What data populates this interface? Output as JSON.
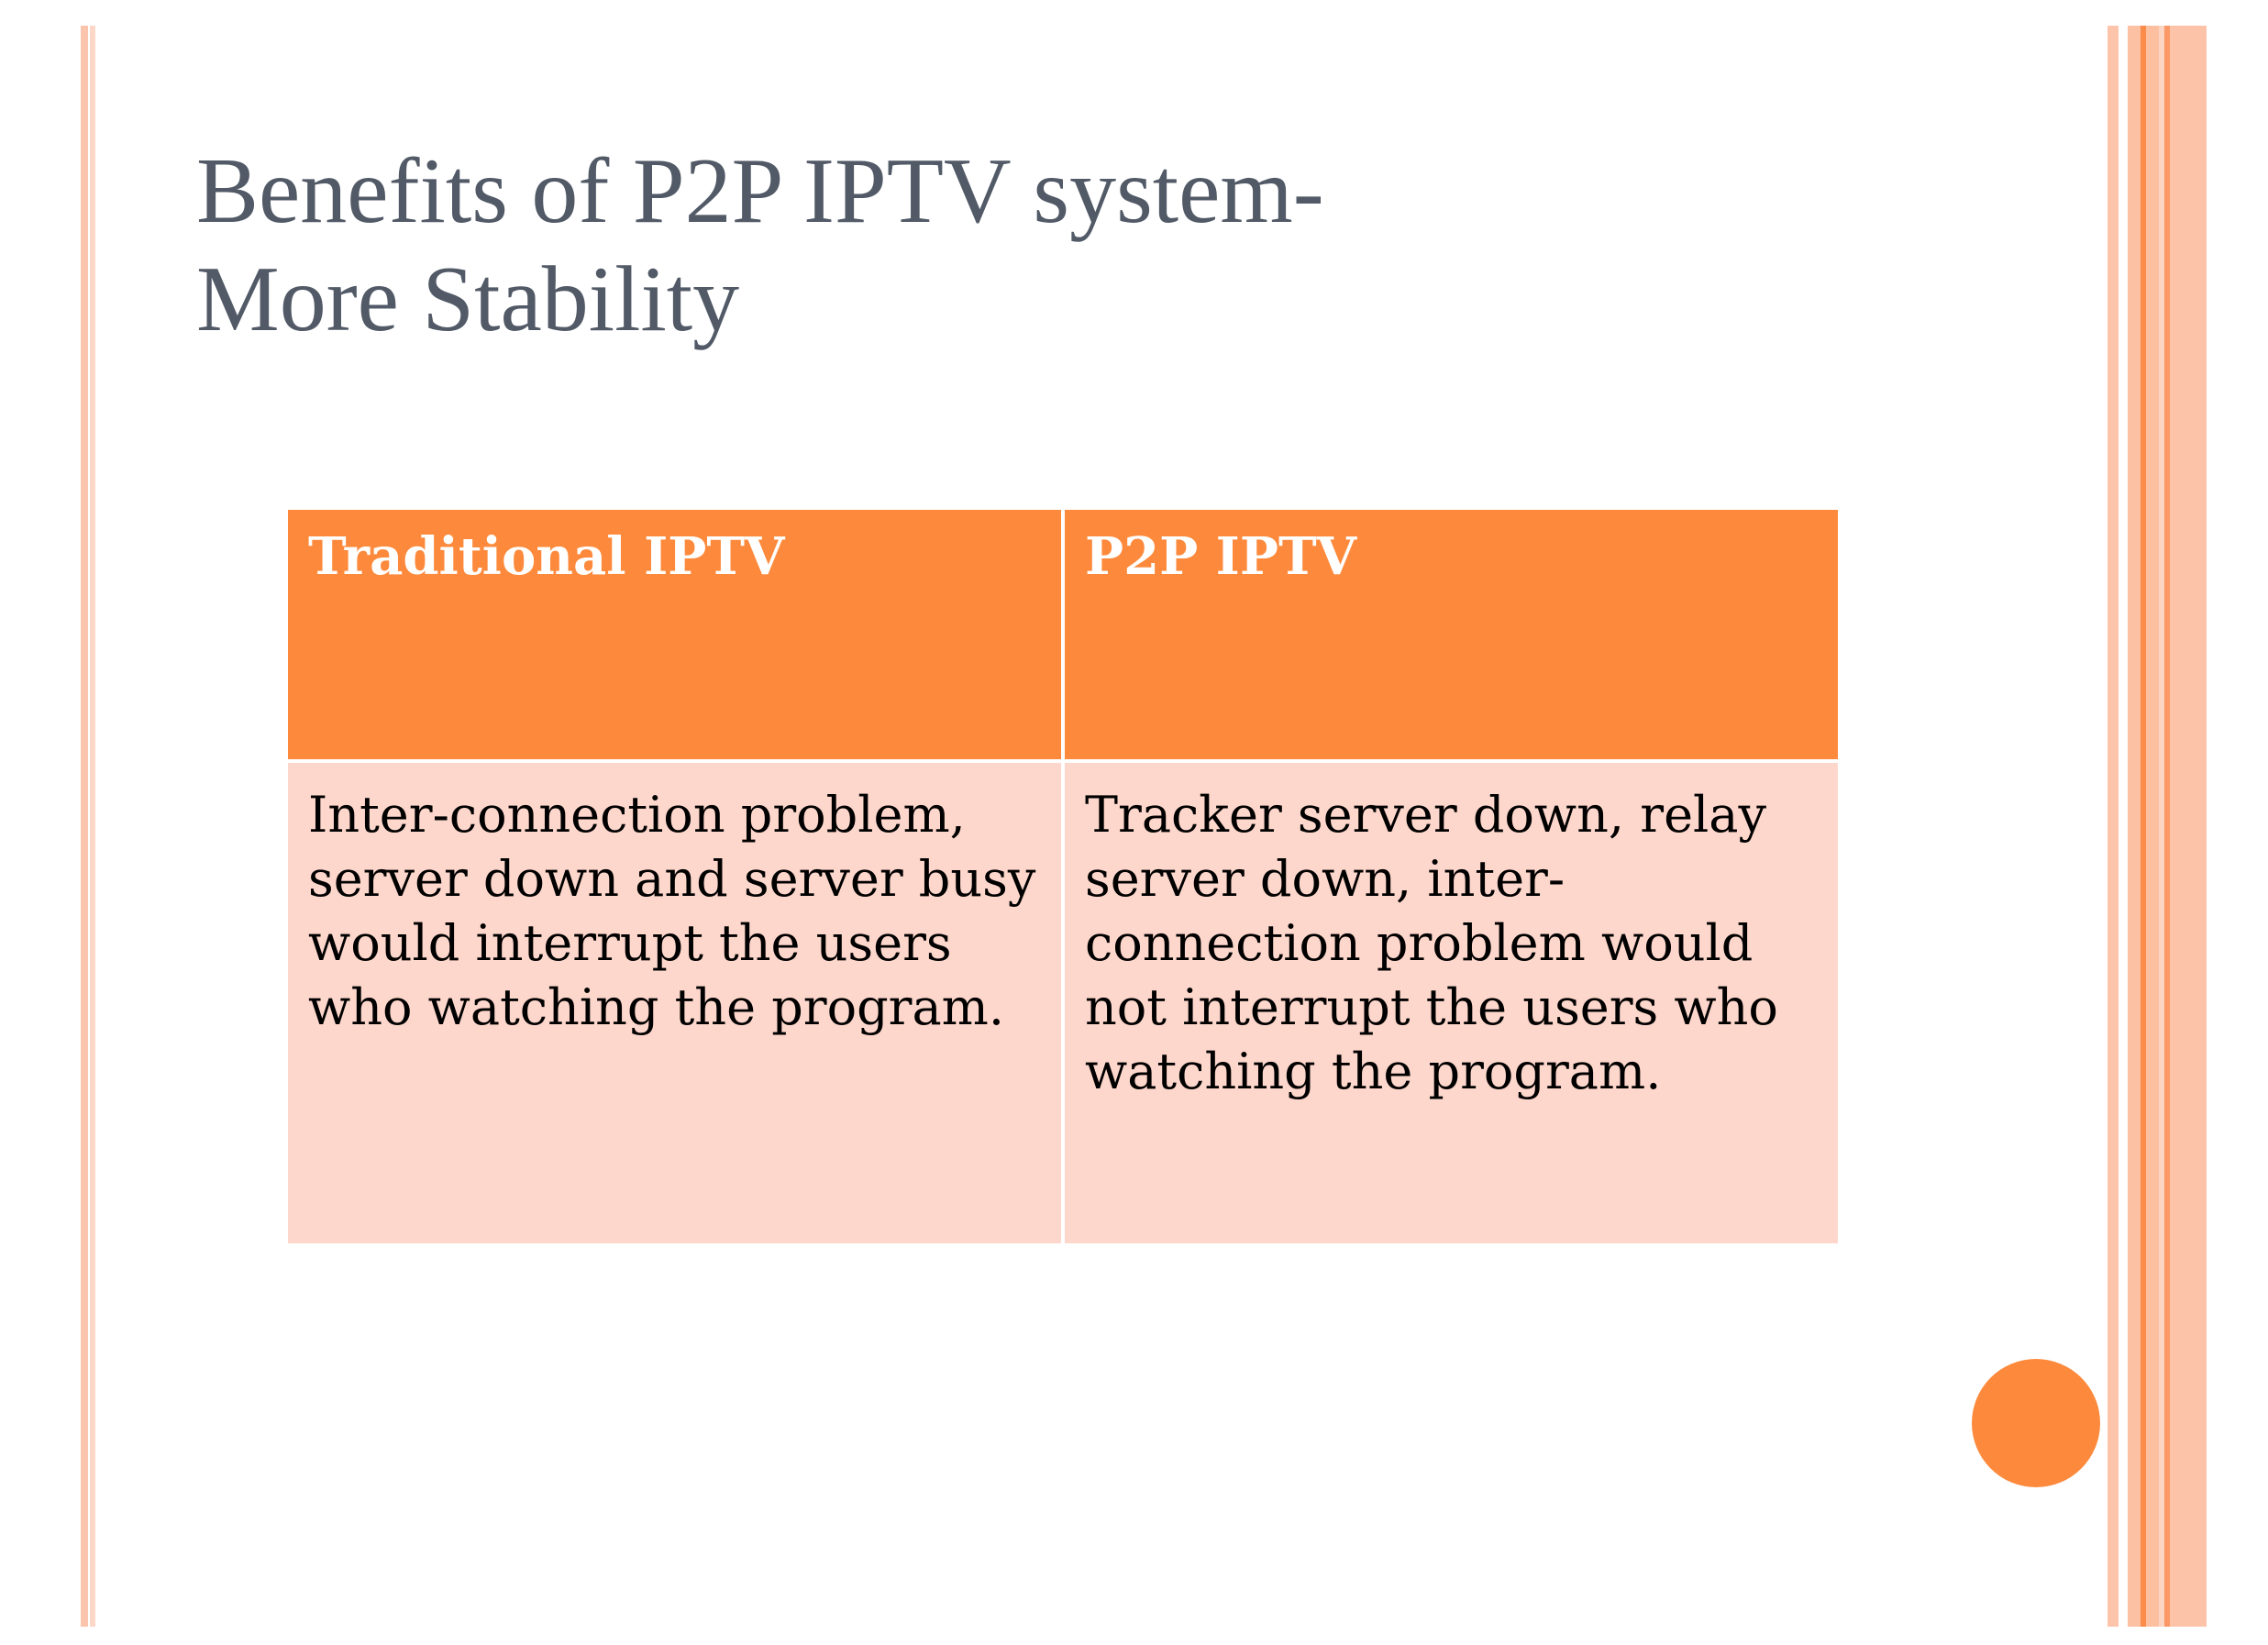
{
  "slide": {
    "title_line1": "Benefits of P2P IPTV system-",
    "title_line2": "More Stability",
    "table": {
      "headers": [
        "Traditional IPTV",
        "P2P IPTV"
      ],
      "rows": [
        [
          "Inter-connection problem, server down and server busy would interrupt the users who watching the program.",
          "Tracker server down, relay server down, inter-connection problem would not interrupt the users who watching the program."
        ]
      ]
    }
  },
  "colors": {
    "accent_orange": "#fd8a3c",
    "light_orange": "#fed7cc",
    "stripe_peach": "#fcc4ab",
    "title_gray": "#525a67"
  }
}
